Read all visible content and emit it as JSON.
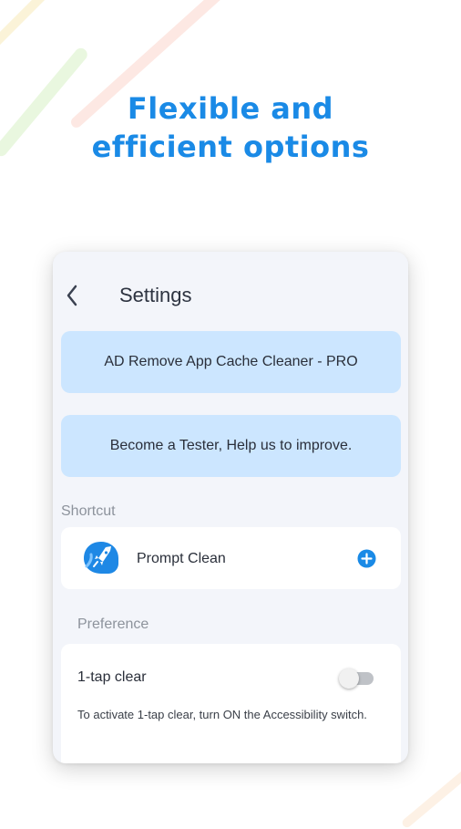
{
  "headline": {
    "line1": "Flexible and",
    "line2": "efficient options"
  },
  "settings": {
    "title": "Settings",
    "pro_label": "AD Remove App Cache Cleaner - PRO",
    "tester_label": "Become a Tester, Help us to improve.",
    "shortcut": {
      "section_label": "Shortcut",
      "item_label": "Prompt Clean",
      "icon": "rocket-icon",
      "action_icon": "plus-circle-icon"
    },
    "preference": {
      "section_label": "Preference",
      "tap_clear_label": "1-tap clear",
      "tap_clear_on": false,
      "tap_clear_desc": "To activate 1-tap clear, turn ON the Accessibility switch."
    }
  },
  "colors": {
    "accent": "#1a8ae6",
    "pill_bg": "#cce6ff",
    "card_bg": "#f3f5fa"
  }
}
